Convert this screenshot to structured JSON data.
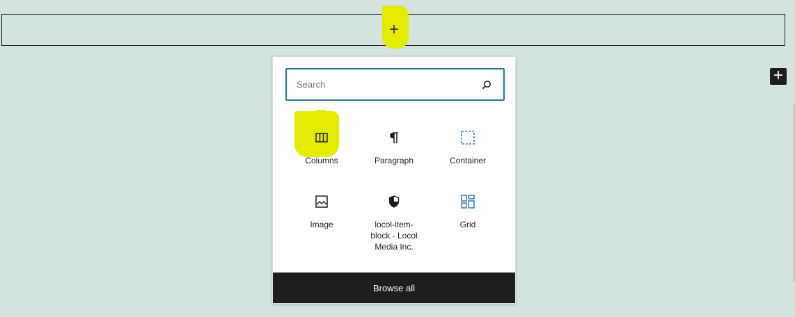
{
  "editor": {
    "appender_icon": "plus-icon",
    "side_inserter_icon": "plus-icon"
  },
  "inserter": {
    "search": {
      "placeholder": "Search",
      "value": "",
      "icon": "search-icon"
    },
    "blocks": [
      {
        "label": "Columns",
        "icon": "columns-icon"
      },
      {
        "label": "Paragraph",
        "icon": "paragraph-icon"
      },
      {
        "label": "Container",
        "icon": "container-icon"
      },
      {
        "label": "Image",
        "icon": "image-icon"
      },
      {
        "label": "locol-item-block - Locol Media Inc.",
        "icon": "shield-icon"
      },
      {
        "label": "Grid",
        "icon": "grid-icon"
      }
    ],
    "browse_all_label": "Browse all"
  },
  "colors": {
    "canvas_background": "#d2e4dd",
    "highlight": "#e3ec00",
    "focus_border": "#1f7a8e",
    "dark": "#1e1e1e",
    "accent_blue": "#3a7fc1"
  }
}
